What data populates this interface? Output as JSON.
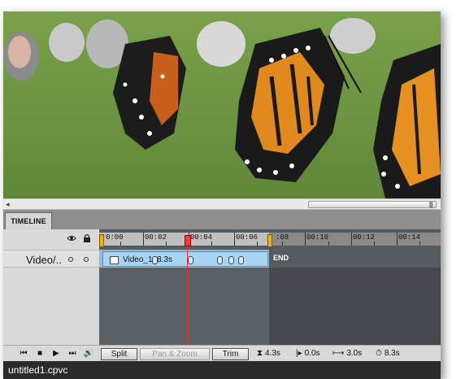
{
  "timeline": {
    "tab_label": "TIMELINE",
    "ruler_labels": [
      "0:00",
      "00:02",
      "00:04",
      "00:06",
      ":08",
      "00:10",
      "00:12",
      "00:14"
    ],
    "track_name": "Video/..",
    "clip_label": "Video_1: 8.3s",
    "end_label": "END"
  },
  "toolbar": {
    "split_label": "Split",
    "pan_zoom_label": "Pan & Zoom",
    "trim_label": "Trim",
    "stats": [
      {
        "icon": "hourglass-icon",
        "symbol": "⧗",
        "value": "4.3s"
      },
      {
        "icon": "transition-in-icon",
        "symbol": "|▸",
        "value": "0.0s"
      },
      {
        "icon": "span-icon",
        "symbol": "⟼",
        "value": "3.0s"
      },
      {
        "icon": "stopwatch-icon",
        "symbol": "⏱",
        "value": "8.3s"
      }
    ]
  },
  "status": {
    "filename": "untitled1.cpvc"
  },
  "colors": {
    "accent_marker": "#f2b400",
    "playhead": "#ff2b2b",
    "clip_fill": "#a8d4f4",
    "preview_green": "#6e9642"
  }
}
